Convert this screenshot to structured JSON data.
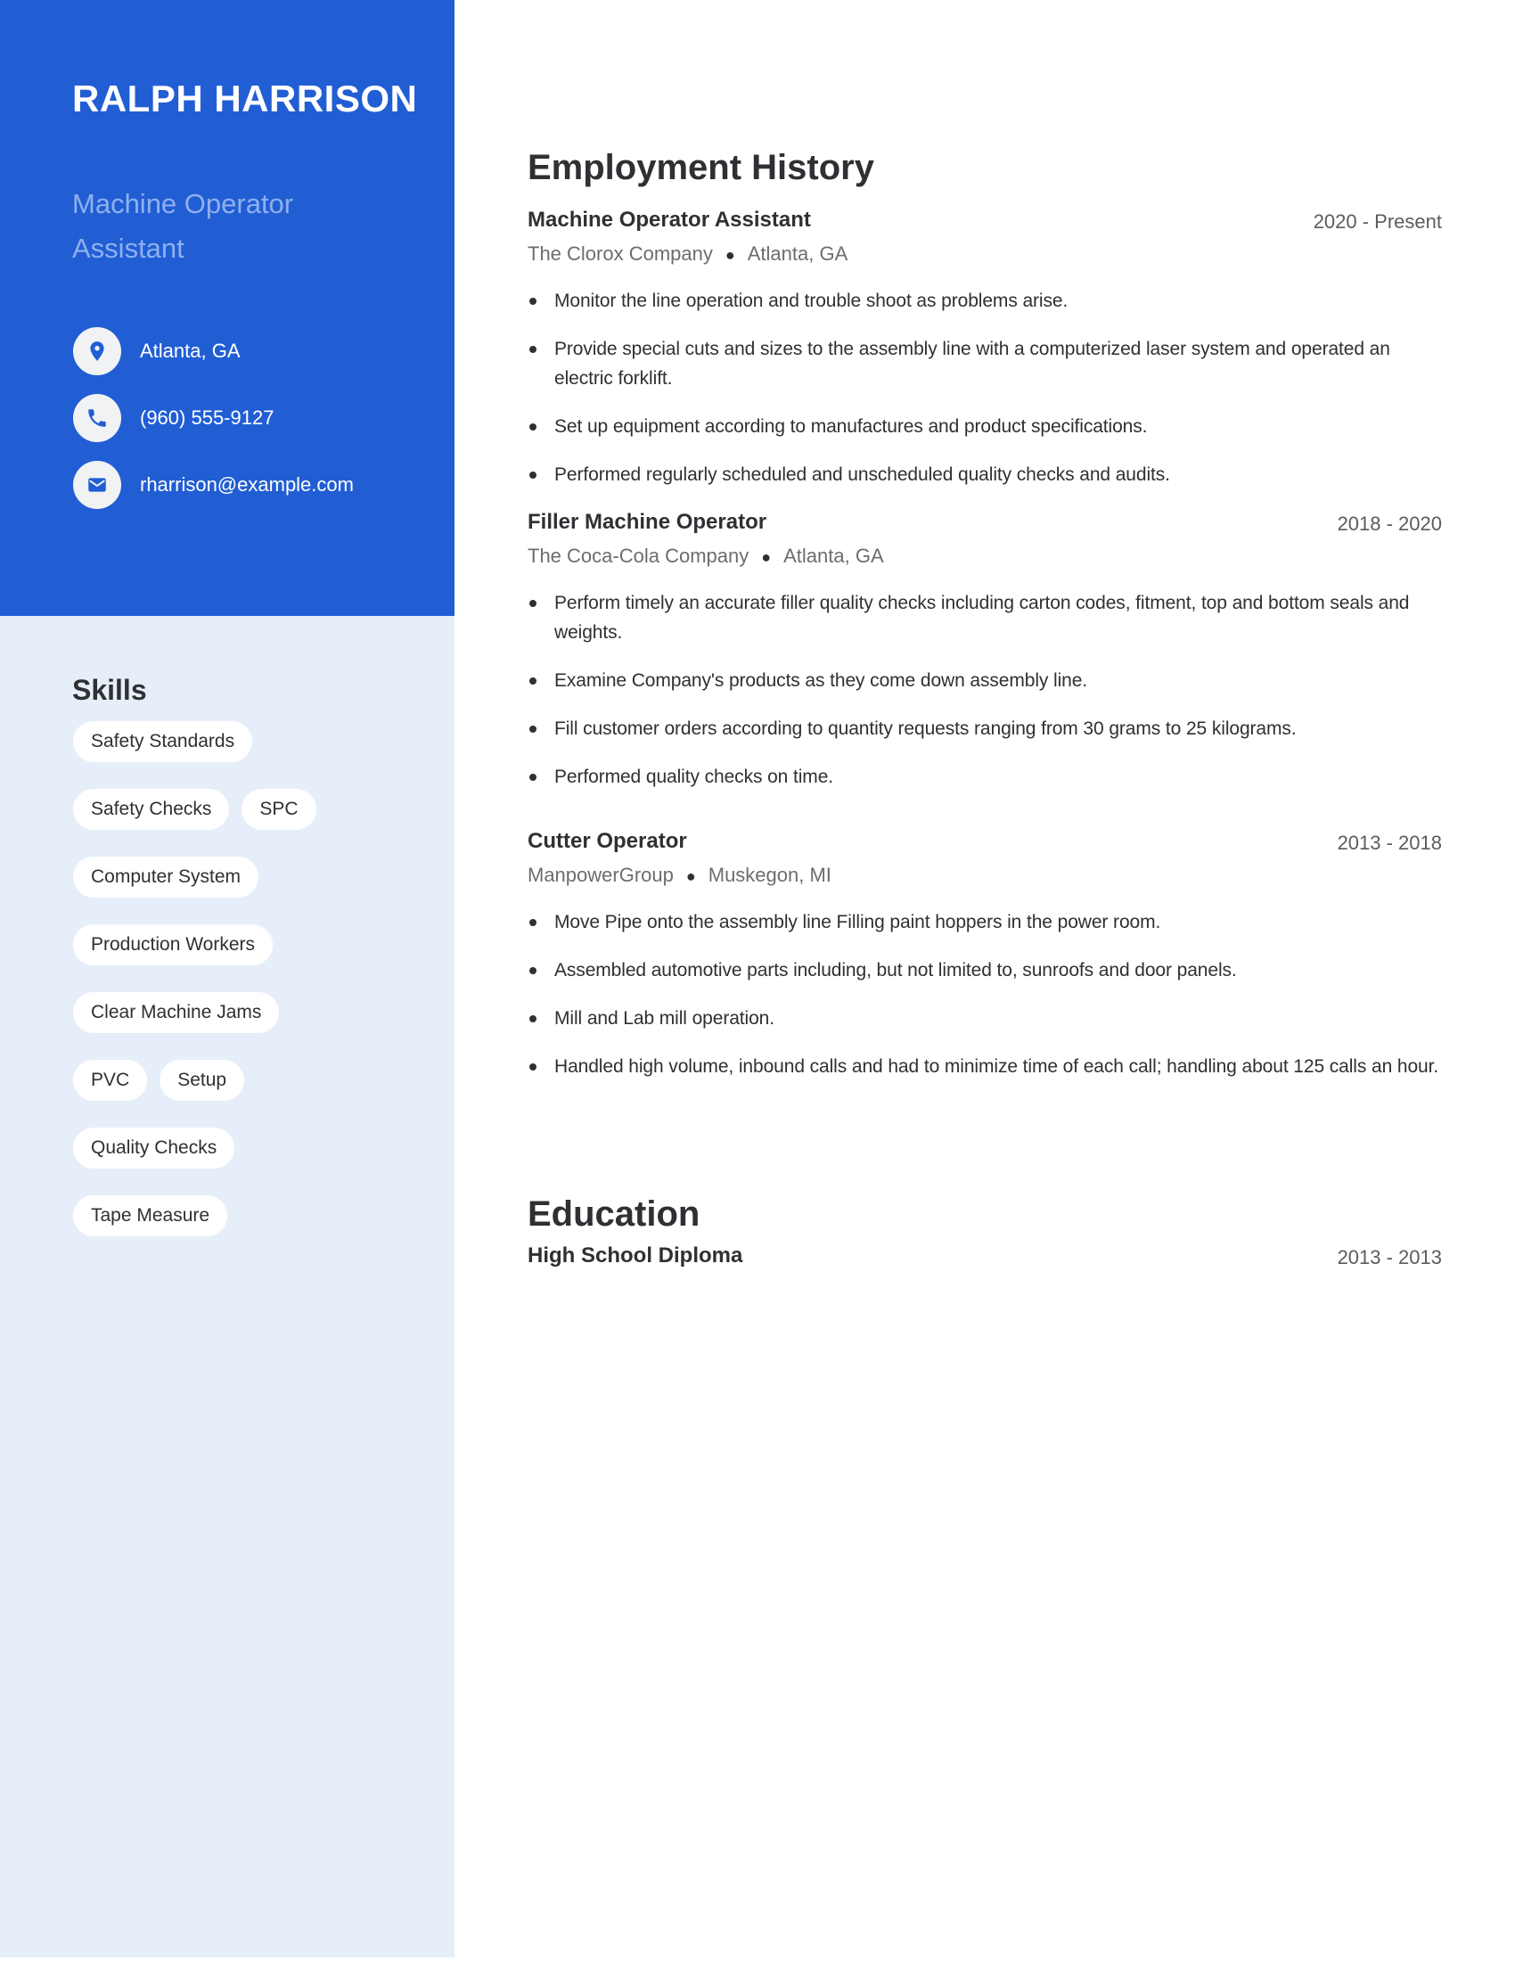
{
  "header": {
    "name": "RALPH HARRISON",
    "title": "Machine Operator Assistant"
  },
  "contact": [
    {
      "icon": "location-pin-icon",
      "text": "Atlanta, GA"
    },
    {
      "icon": "phone-icon",
      "text": "(960) 555-9127"
    },
    {
      "icon": "mail-icon",
      "text": "rharrison@example.com"
    }
  ],
  "skills": {
    "title": "Skills",
    "items": [
      "Safety Standards",
      "Safety Checks",
      "SPC",
      "Computer System",
      "Production Workers",
      "Clear Machine Jams",
      "PVC",
      "Setup",
      "Quality Checks",
      "Tape Measure"
    ]
  },
  "employment": {
    "title": "Employment History",
    "jobs": [
      {
        "title": "Machine Operator Assistant",
        "dates": "2020 - Present",
        "company": "The Clorox Company",
        "location": "Atlanta, GA",
        "bullets": [
          "Monitor the line operation and trouble shoot as problems arise.",
          "Provide special cuts and sizes to the assembly line with a computerized laser system and operated an electric forklift.",
          "Set up equipment according to manufactures and product specifications.",
          "Performed regularly scheduled and unscheduled quality checks and audits."
        ]
      },
      {
        "title": "Filler Machine Operator",
        "dates": "2018 - 2020",
        "company": "The Coca-Cola Company",
        "location": "Atlanta, GA",
        "bullets": [
          "Perform timely an accurate filler quality checks including carton codes, fitment, top and bottom seals and weights.",
          "Examine Company's products as they come down assembly line.",
          "Fill customer orders according to quantity requests ranging from 30 grams to 25 kilograms.",
          "Performed quality checks on time."
        ]
      },
      {
        "title": "Cutter Operator",
        "dates": "2013 - 2018",
        "company": "ManpowerGroup",
        "location": "Muskegon, MI",
        "bullets": [
          "Move Pipe onto the assembly line Filling paint hoppers in the power room.",
          "Assembled automotive parts including, but not limited to, sunroofs and door panels.",
          "Mill and Lab mill operation.",
          "Handled high volume, inbound calls and had to minimize time of each call; handling about 125 calls an hour."
        ]
      }
    ]
  },
  "education": {
    "title": "Education",
    "items": [
      {
        "degree": "High School Diploma",
        "dates": "2013 - 2013"
      }
    ]
  },
  "colors": {
    "accent": "#215ed4",
    "sidebar_light": "#e6eef9",
    "subtitle": "#8fb0ef",
    "text": "#2e3033",
    "muted": "#6b6d71"
  }
}
